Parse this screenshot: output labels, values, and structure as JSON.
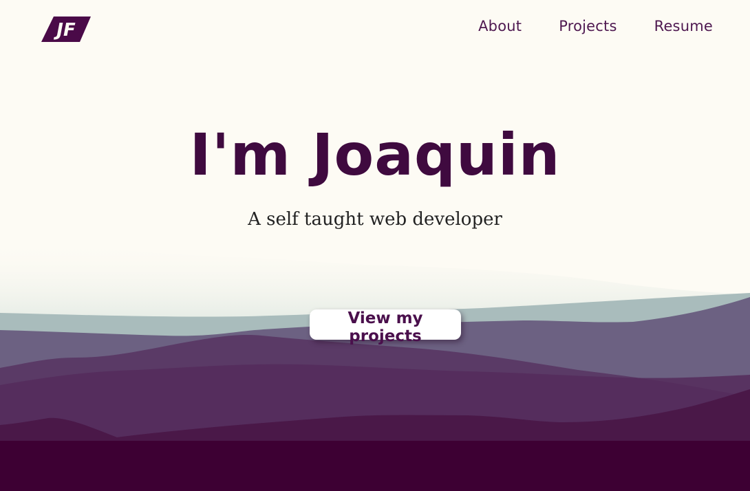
{
  "header": {
    "logo_text": "JF",
    "nav": [
      {
        "label": "About"
      },
      {
        "label": "Projects"
      },
      {
        "label": "Resume"
      }
    ]
  },
  "hero": {
    "title": "I'm Joaquin",
    "subtitle": "A self taught web developer",
    "cta_label": "View my projects"
  },
  "colors": {
    "background": "#fdfbf4",
    "brand": "#3f0a3f",
    "nav_text": "#4e1850",
    "footer_band": "#3d0033"
  }
}
